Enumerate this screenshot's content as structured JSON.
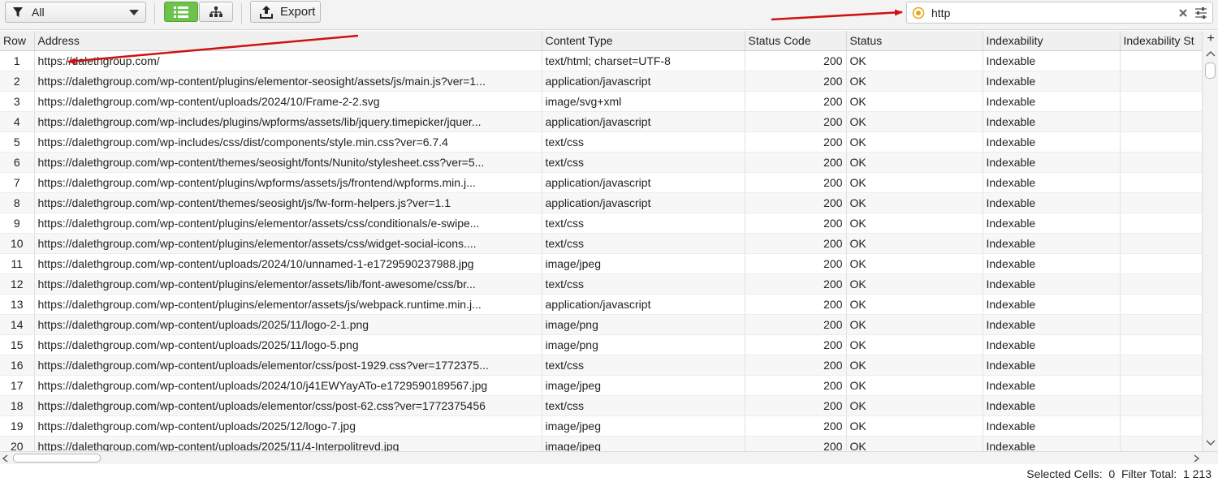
{
  "toolbar": {
    "filter_value": "All",
    "export_label": "Export",
    "search_value": "http"
  },
  "table": {
    "headers": [
      "Row",
      "Address",
      "Content Type",
      "Status Code",
      "Status",
      "Indexability",
      "Indexability St"
    ],
    "rows": [
      [
        "1",
        "https://dalethgroup.com/",
        "text/html; charset=UTF-8",
        "200",
        "OK",
        "Indexable"
      ],
      [
        "2",
        "https://dalethgroup.com/wp-content/plugins/elementor-seosight/assets/js/main.js?ver=1...",
        "application/javascript",
        "200",
        "OK",
        "Indexable"
      ],
      [
        "3",
        "https://dalethgroup.com/wp-content/uploads/2024/10/Frame-2-2.svg",
        "image/svg+xml",
        "200",
        "OK",
        "Indexable"
      ],
      [
        "4",
        "https://dalethgroup.com/wp-includes/plugins/wpforms/assets/lib/jquery.timepicker/jquer...",
        "application/javascript",
        "200",
        "OK",
        "Indexable"
      ],
      [
        "5",
        "https://dalethgroup.com/wp-includes/css/dist/components/style.min.css?ver=6.7.4",
        "text/css",
        "200",
        "OK",
        "Indexable"
      ],
      [
        "6",
        "https://dalethgroup.com/wp-content/themes/seosight/fonts/Nunito/stylesheet.css?ver=5...",
        "text/css",
        "200",
        "OK",
        "Indexable"
      ],
      [
        "7",
        "https://dalethgroup.com/wp-content/plugins/wpforms/assets/js/frontend/wpforms.min.j...",
        "application/javascript",
        "200",
        "OK",
        "Indexable"
      ],
      [
        "8",
        "https://dalethgroup.com/wp-content/themes/seosight/js/fw-form-helpers.js?ver=1.1",
        "application/javascript",
        "200",
        "OK",
        "Indexable"
      ],
      [
        "9",
        "https://dalethgroup.com/wp-content/plugins/elementor/assets/css/conditionals/e-swipe...",
        "text/css",
        "200",
        "OK",
        "Indexable"
      ],
      [
        "10",
        "https://dalethgroup.com/wp-content/plugins/elementor/assets/css/widget-social-icons....",
        "text/css",
        "200",
        "OK",
        "Indexable"
      ],
      [
        "11",
        "https://dalethgroup.com/wp-content/uploads/2024/10/unnamed-1-e1729590237988.jpg",
        "image/jpeg",
        "200",
        "OK",
        "Indexable"
      ],
      [
        "12",
        "https://dalethgroup.com/wp-content/plugins/elementor/assets/lib/font-awesome/css/br...",
        "text/css",
        "200",
        "OK",
        "Indexable"
      ],
      [
        "13",
        "https://dalethgroup.com/wp-content/plugins/elementor/assets/js/webpack.runtime.min.j...",
        "application/javascript",
        "200",
        "OK",
        "Indexable"
      ],
      [
        "14",
        "https://dalethgroup.com/wp-content/uploads/2025/11/logo-2-1.png",
        "image/png",
        "200",
        "OK",
        "Indexable"
      ],
      [
        "15",
        "https://dalethgroup.com/wp-content/uploads/2025/11/logo-5.png",
        "image/png",
        "200",
        "OK",
        "Indexable"
      ],
      [
        "16",
        "https://dalethgroup.com/wp-content/uploads/elementor/css/post-1929.css?ver=1772375...",
        "text/css",
        "200",
        "OK",
        "Indexable"
      ],
      [
        "17",
        "https://dalethgroup.com/wp-content/uploads/2024/10/j41EWYayATo-e1729590189567.jpg",
        "image/jpeg",
        "200",
        "OK",
        "Indexable"
      ],
      [
        "18",
        "https://dalethgroup.com/wp-content/uploads/elementor/css/post-62.css?ver=1772375456",
        "text/css",
        "200",
        "OK",
        "Indexable"
      ],
      [
        "19",
        "https://dalethgroup.com/wp-content/uploads/2025/12/logo-7.jpg",
        "image/jpeg",
        "200",
        "OK",
        "Indexable"
      ],
      [
        "20",
        "https://dalethgroup.com/wp-content/uploads/2025/11/4-Interpolitrevd.jpg",
        "image/jpeg",
        "200",
        "OK",
        "Indexable"
      ]
    ]
  },
  "status_bar": {
    "text": "Selected Cells:  0  Filter Total:  1 213"
  },
  "colors": {
    "accent_green": "#6cc24a",
    "annotation_red": "#d01010",
    "search_icon": "#e6a817"
  },
  "icons": [
    "filter-icon",
    "list-view-icon",
    "tree-view-icon",
    "export-icon",
    "search-target-icon",
    "clear-icon",
    "settings-sliders-icon",
    "add-column-icon"
  ]
}
